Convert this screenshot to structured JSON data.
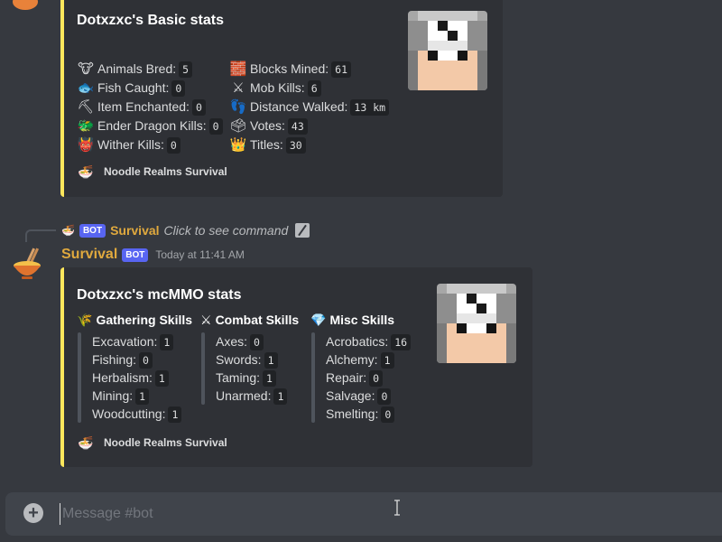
{
  "basic_embed": {
    "title": "Dotxzxc's Basic stats",
    "left_stats": [
      {
        "icon": "🐮",
        "label": "Animals Bred:",
        "value": "5"
      },
      {
        "icon": "🐟",
        "label": "Fish Caught:",
        "value": "0"
      },
      {
        "icon": "⛏",
        "label": "Item Enchanted:",
        "value": "0"
      },
      {
        "icon": "🐲",
        "label": "Ender Dragon Kills:",
        "value": "0"
      },
      {
        "icon": "👹",
        "label": "Wither Kills:",
        "value": "0"
      }
    ],
    "right_stats": [
      {
        "icon": "🧱",
        "label": "Blocks Mined:",
        "value": "61"
      },
      {
        "icon": "⚔",
        "label": "Mob Kills:",
        "value": "6"
      },
      {
        "icon": "👣",
        "label": "Distance Walked:",
        "value": "13 km"
      },
      {
        "icon": "🗳",
        "label": "Votes:",
        "value": "43"
      },
      {
        "icon": "👑",
        "label": "Titles:",
        "value": "30"
      }
    ],
    "footer": "Noodle Realms Survival"
  },
  "reply": {
    "badge": "BOT",
    "author": "Survival",
    "text": "Click to see command"
  },
  "message": {
    "author": "Survival",
    "badge": "BOT",
    "timestamp": "Today at 11:41 AM"
  },
  "mcmmo_embed": {
    "title": "Dotxzxc's mcMMO stats",
    "fields": [
      {
        "icon": "🌾",
        "title": "Gathering Skills",
        "items": [
          {
            "label": "Excavation:",
            "value": "1"
          },
          {
            "label": "Fishing:",
            "value": "0"
          },
          {
            "label": "Herbalism:",
            "value": "1"
          },
          {
            "label": "Mining:",
            "value": "1"
          },
          {
            "label": "Woodcutting:",
            "value": "1"
          }
        ]
      },
      {
        "icon": "⚔",
        "title": "Combat Skills",
        "items": [
          {
            "label": "Axes:",
            "value": "0"
          },
          {
            "label": "Swords:",
            "value": "1"
          },
          {
            "label": "Taming:",
            "value": "1"
          },
          {
            "label": "Unarmed:",
            "value": "1"
          }
        ]
      },
      {
        "icon": "💎",
        "title": "Misc Skills",
        "items": [
          {
            "label": "Acrobatics:",
            "value": "16"
          },
          {
            "label": "Alchemy:",
            "value": "1"
          },
          {
            "label": "Repair:",
            "value": "0"
          },
          {
            "label": "Salvage:",
            "value": "0"
          },
          {
            "label": "Smelting:",
            "value": "0"
          }
        ]
      }
    ],
    "footer": "Noodle Realms Survival"
  },
  "composer": {
    "placeholder": "Message #bot"
  },
  "colors": {
    "accent_bar": "#fee75c",
    "author_name": "#e0a93e",
    "bot_badge": "#5865f2"
  }
}
